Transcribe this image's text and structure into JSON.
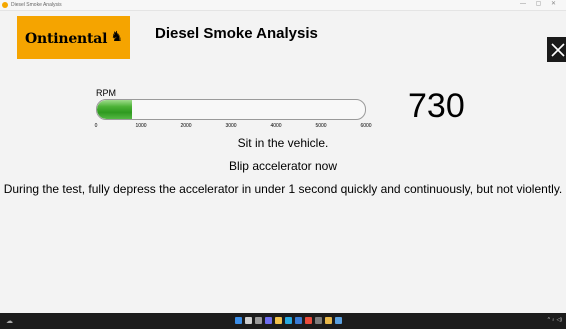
{
  "window": {
    "title": "Diesel Smoke Analysis",
    "controls": "— ▢ ✕"
  },
  "header": {
    "logo_text": "ntinental",
    "logo_prefix": "O",
    "title": "Diesel Smoke Analysis"
  },
  "gauge": {
    "label": "RPM",
    "value": 730,
    "value_text": "730",
    "min": 0,
    "max": 6000,
    "ticks": [
      "0",
      "1000",
      "2000",
      "3000",
      "4000",
      "5000",
      "6000"
    ],
    "fill_color": "#3aa52a"
  },
  "messages": {
    "line1": "Sit in the vehicle.",
    "line2": "Blip accelerator now",
    "line3": "During the test, fully depress the accelerator in under 1 second quickly and continuously, but not violently."
  },
  "taskbar": {
    "icons": [
      "start-icon",
      "search-icon",
      "task-view-icon",
      "chat-icon",
      "file-explorer-icon",
      "edge-icon",
      "store-icon",
      "chrome-icon",
      "settings-icon",
      "folder-icon",
      "app-icon"
    ],
    "tray_text": "^ ♁ ◁)"
  },
  "colors": {
    "brand": "#f5a400",
    "background": "#f3f3f3"
  }
}
